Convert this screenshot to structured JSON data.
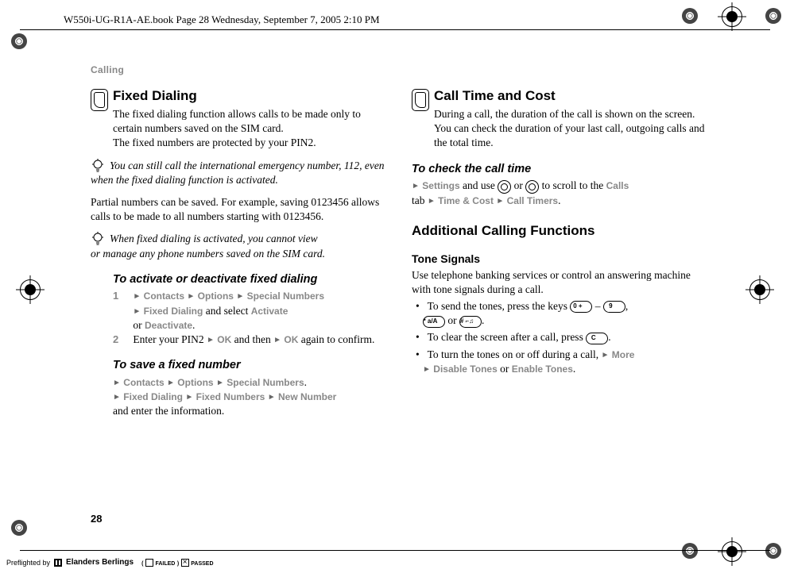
{
  "header": {
    "text": "W550i-UG-R1A-AE.book  Page 28  Wednesday, September 7, 2005  2:10 PM"
  },
  "section_header": "Calling",
  "page_number": "28",
  "col1": {
    "fixed_dialing": {
      "title": "Fixed Dialing",
      "p1a": "The fixed dialing function allows calls to be made only to certain numbers saved on the SIM card. ",
      "p1b": "The fixed numbers are protected by your PIN2.",
      "note1": "You can still call the international emergency number, 112, even when the fixed dialing function is activated.",
      "p2": "Partial numbers can be saved. For example, saving 0123456 allows calls to be made to all numbers starting with 0123456.",
      "note2a": "When fixed dialing is activated, you cannot view ",
      "note2b": "or manage any phone numbers saved on the SIM card.",
      "sub1": "To activate or deactivate fixed dialing",
      "step1_num": "1",
      "step1_contacts": "Contacts",
      "step1_options": "Options",
      "step1_special": "Special Numbers",
      "step1_fixed": "Fixed Dialing",
      "step1_select": " and select ",
      "step1_activate": "Activate",
      "step1_or": "or ",
      "step1_deactivate": "Deactivate",
      "step2_num": "2",
      "step2_text": "Enter your PIN2 ",
      "step2_ok": "OK",
      "step2_then": " and then ",
      "step2_again": " again to confirm.",
      "sub2": "To save a fixed number",
      "save_contacts": "Contacts",
      "save_options": "Options",
      "save_special": "Special Numbers",
      "save_fixed": "Fixed Dialing",
      "save_fixednum": "Fixed Numbers",
      "save_new": "New Number",
      "save_end": "and enter the information."
    }
  },
  "col2": {
    "call_time": {
      "title": "Call Time and Cost",
      "p1": "During a call, the duration of the call is shown on the screen. You can check the duration of your last call, outgoing calls and the total time.",
      "sub1": "To check the call time",
      "check_settings": "Settings",
      "check_use": " and use ",
      "check_or": " or ",
      "check_scroll": " to scroll to the ",
      "check_calls": "Calls",
      "check_tab": "tab ",
      "check_time": "Time & Cost",
      "check_timers": "Call Timers"
    },
    "additional": {
      "title": "Additional Calling Functions",
      "tone_title": "Tone Signals",
      "tone_p1": "Use telephone banking services or control an answering machine with tone signals during a call.",
      "b1_text": "To send the tones, press the keys ",
      "b1_dash": " – ",
      "b1_comma": ", ",
      "b1_or": " or ",
      "b2_text": "To clear the screen after a call, press ",
      "b3_text": "To turn the tones on or off during a call, ",
      "b3_more": "More",
      "b3_disable": "Disable Tones",
      "b3_or": " or ",
      "b3_enable": "Enable Tones"
    }
  },
  "keys": {
    "zero": "0 +",
    "nine": "9",
    "star": "* a/A",
    "hash": "# ⌐♫",
    "c": "C"
  },
  "footer": {
    "preflight": "Preflighted by",
    "brand": "Elanders Berlings",
    "failed": "FAILED",
    "passed": "PASSED"
  }
}
